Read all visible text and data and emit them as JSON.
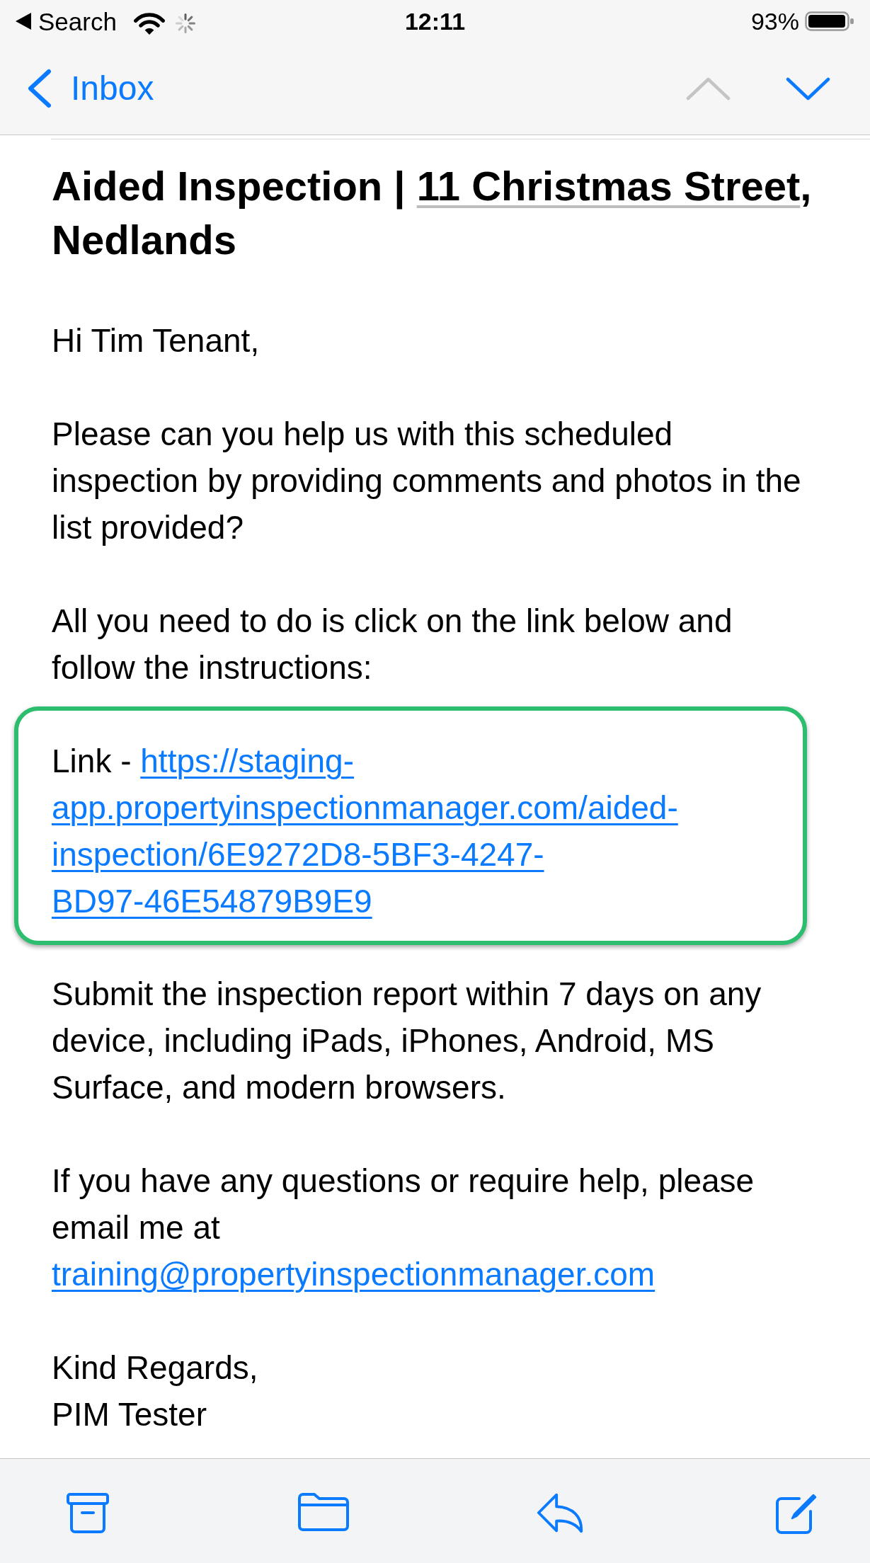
{
  "status_bar": {
    "back_app": "Search",
    "time": "12:11",
    "battery": "93%"
  },
  "nav_bar": {
    "back_label": "Inbox",
    "message_arrows": [
      {
        "kind": "up",
        "disabled": true
      },
      {
        "kind": "down",
        "disabled": false
      }
    ]
  },
  "message": {
    "subject": [
      {
        "kind": "text",
        "text": "Aided Inspection | "
      },
      {
        "kind": "address",
        "text": "11 Christmas Street"
      },
      {
        "kind": "text",
        "text": ", Nedlands"
      }
    ],
    "body": [
      {
        "kind": "text",
        "text": "Hi Tim Tenant,"
      },
      {
        "kind": "text",
        "text": "Please can you help us with this scheduled inspection by providing comments and photos in the list provided?"
      },
      {
        "kind": "text",
        "text": "All you need to do is click on the link below and follow the instructions:"
      },
      {
        "kind": "link_box",
        "label": "Link -",
        "url": "https://staging-app.propertyinspectionmanager.com/aided-inspection/6E9272D8-5BF3-4247-BD97-46E54879B9E9"
      },
      {
        "kind": "text",
        "text": "Submit the inspection report within 7 days on any device, including iPads, iPhones, Android, MS Surface, and modern browsers."
      },
      {
        "kind": "contact",
        "text": "If you have any questions or require help, please email me at",
        "email": "training@propertyinspectionmanager.com"
      },
      {
        "kind": "signature",
        "lines": [
          "Kind Regards,",
          "PIM Tester"
        ]
      }
    ]
  },
  "toolbar": [
    {
      "kind": "archive"
    },
    {
      "kind": "folder"
    },
    {
      "kind": "reply"
    },
    {
      "kind": "compose"
    }
  ]
}
